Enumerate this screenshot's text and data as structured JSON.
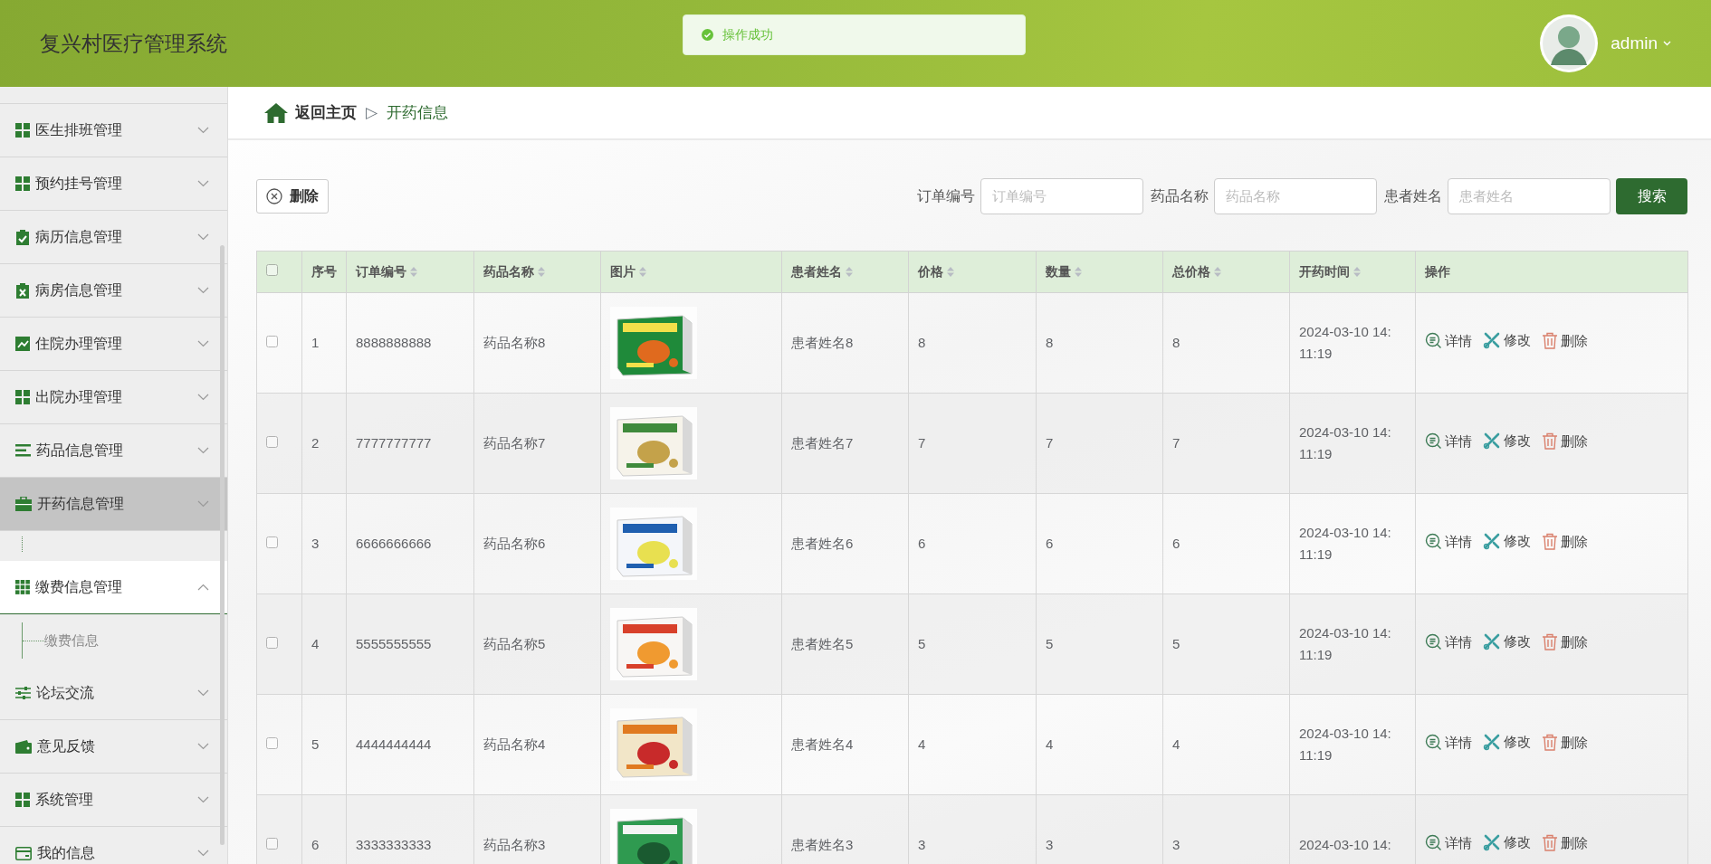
{
  "header": {
    "title": "复兴村医疗管理系统",
    "toast": {
      "message": "操作成功"
    },
    "user": {
      "name": "admin"
    }
  },
  "sidebar": {
    "items": [
      {
        "label": "医生排班管理",
        "selected": false,
        "expanded": false
      },
      {
        "label": "预约挂号管理",
        "selected": false,
        "expanded": false
      },
      {
        "label": "病历信息管理",
        "selected": false,
        "expanded": false
      },
      {
        "label": "病房信息管理",
        "selected": false,
        "expanded": false
      },
      {
        "label": "住院办理管理",
        "selected": false,
        "expanded": false
      },
      {
        "label": "出院办理管理",
        "selected": false,
        "expanded": false
      },
      {
        "label": "药品信息管理",
        "selected": false,
        "expanded": false
      },
      {
        "label": "开药信息管理",
        "selected": true,
        "expanded": false,
        "collapsing": true
      },
      {
        "label": "缴费信息管理",
        "selected": false,
        "expanded": true,
        "children": [
          {
            "label": "缴费信息"
          }
        ]
      },
      {
        "label": "论坛交流",
        "selected": false,
        "expanded": false
      },
      {
        "label": "意见反馈",
        "selected": false,
        "expanded": false
      },
      {
        "label": "系统管理",
        "selected": false,
        "expanded": false
      },
      {
        "label": "我的信息",
        "selected": false,
        "expanded": false
      }
    ]
  },
  "breadcrumb": {
    "home": "返回主页",
    "separator": "▷",
    "current": "开药信息"
  },
  "toolbar": {
    "delete_button": "删除",
    "filters": [
      {
        "label": "订单编号",
        "placeholder": "订单编号"
      },
      {
        "label": "药品名称",
        "placeholder": "药品名称"
      },
      {
        "label": "患者姓名",
        "placeholder": "患者姓名"
      }
    ],
    "search_button": "搜索"
  },
  "table": {
    "all_checked": false,
    "columns": [
      {
        "label": "序号",
        "sortable": false
      },
      {
        "label": "订单编号",
        "sortable": true
      },
      {
        "label": "药品名称",
        "sortable": true
      },
      {
        "label": "图片",
        "sortable": true
      },
      {
        "label": "患者姓名",
        "sortable": true
      },
      {
        "label": "价格",
        "sortable": true
      },
      {
        "label": "数量",
        "sortable": true
      },
      {
        "label": "总价格",
        "sortable": true
      },
      {
        "label": "开药时间",
        "sortable": true
      },
      {
        "label": "操作",
        "sortable": false
      }
    ],
    "rows": [
      {
        "checked": false,
        "index": "1",
        "order_no": "8888888888",
        "drug": "药品名称8",
        "patient": "患者姓名8",
        "price": "8",
        "quantity": "8",
        "total": "8",
        "time": "2024-03-10 14:11:19",
        "actions": [
          "详情",
          "修改",
          "删除"
        ]
      },
      {
        "checked": false,
        "index": "2",
        "order_no": "7777777777",
        "drug": "药品名称7",
        "patient": "患者姓名7",
        "price": "7",
        "quantity": "7",
        "total": "7",
        "time": "2024-03-10 14:11:19",
        "actions": [
          "详情",
          "修改",
          "删除"
        ]
      },
      {
        "checked": false,
        "index": "3",
        "order_no": "6666666666",
        "drug": "药品名称6",
        "patient": "患者姓名6",
        "price": "6",
        "quantity": "6",
        "total": "6",
        "time": "2024-03-10 14:11:19",
        "actions": [
          "详情",
          "修改",
          "删除"
        ]
      },
      {
        "checked": false,
        "index": "4",
        "order_no": "5555555555",
        "drug": "药品名称5",
        "patient": "患者姓名5",
        "price": "5",
        "quantity": "5",
        "total": "5",
        "time": "2024-03-10 14:11:19",
        "actions": [
          "详情",
          "修改",
          "删除"
        ]
      },
      {
        "checked": false,
        "index": "5",
        "order_no": "4444444444",
        "drug": "药品名称4",
        "patient": "患者姓名4",
        "price": "4",
        "quantity": "4",
        "total": "4",
        "time": "2024-03-10 14:11:19",
        "actions": [
          "详情",
          "修改",
          "删除"
        ]
      },
      {
        "checked": false,
        "index": "6",
        "order_no": "3333333333",
        "drug": "药品名称3",
        "patient": "患者姓名3",
        "price": "3",
        "quantity": "3",
        "total": "3",
        "time": "2024-03-10 14:",
        "actions": [
          "详情",
          "修改",
          "删除"
        ]
      }
    ]
  }
}
